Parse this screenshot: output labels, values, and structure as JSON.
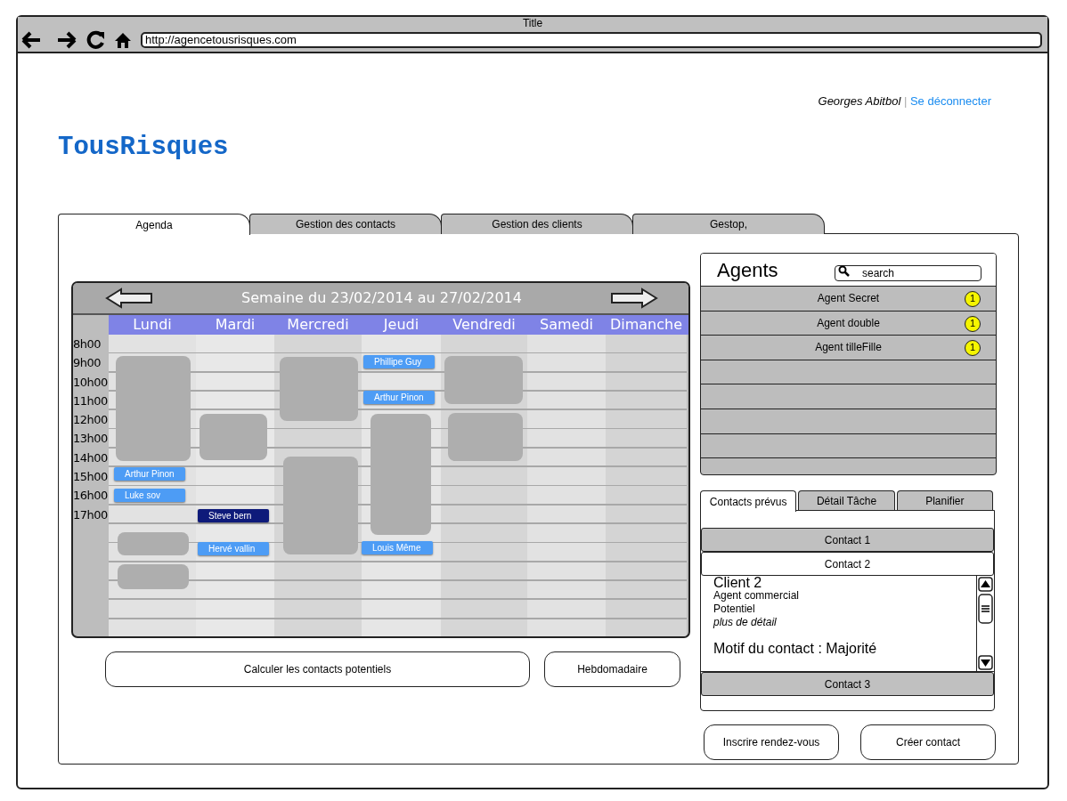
{
  "window": {
    "title": "Title",
    "url": "http://agencetousrisques.com"
  },
  "header": {
    "user": "Georges Abitbol",
    "separator": "|",
    "logout": "Se déconnecter",
    "logo": "TousRisques"
  },
  "tabs": [
    {
      "label": "Agenda",
      "selected": true
    },
    {
      "label": "Gestion des contacts",
      "selected": false
    },
    {
      "label": "Gestion des clients",
      "selected": false
    },
    {
      "label": "Gestop,",
      "selected": false
    }
  ],
  "calendar": {
    "title": "Semaine du 23/02/2014 au 27/02/2014",
    "hours": [
      "8h00",
      "9h00",
      "10h00",
      "11h00",
      "12h00",
      "13h00",
      "14h00",
      "15h00",
      "16h00",
      "17h00"
    ],
    "days": [
      {
        "label": "Lundi",
        "events": [
          {
            "name": "Arthur Pinon",
            "selected": false
          },
          {
            "name": "Luke sov",
            "selected": false
          }
        ]
      },
      {
        "label": "Mardi",
        "events": [
          {
            "name": "Steve bern",
            "selected": true
          },
          {
            "name": "Hervé vallin",
            "selected": false
          }
        ]
      },
      {
        "label": "Mercredi"
      },
      {
        "label": "Jeudi",
        "events": [
          {
            "name": "Phillipe Guy",
            "selected": false
          },
          {
            "name": "Arthur Pinon",
            "selected": false
          },
          {
            "name": "Louis Même",
            "selected": false
          }
        ]
      },
      {
        "label": "Vendredi"
      },
      {
        "label": "Samedi"
      },
      {
        "label": "Dimanche"
      }
    ]
  },
  "actions": [
    "Calculer les contacts potentiels",
    "Hebdomadaire"
  ],
  "agents": {
    "title": "Agents",
    "search": {
      "placeholder": "search"
    },
    "items": [
      {
        "name": "Agent Secret",
        "badge": "1"
      },
      {
        "name": "Agent double",
        "badge": "1"
      },
      {
        "name": "Agent tilleFille",
        "badge": "1"
      }
    ]
  },
  "contacts": {
    "tabs": [
      {
        "label": "Contacts prévus",
        "selected": true
      },
      {
        "label": "Détail Tâche",
        "selected": false
      },
      {
        "label": "Planifier",
        "selected": false
      }
    ],
    "items": [
      {
        "title": "Contact 1",
        "expanded": false
      },
      {
        "title": "Contact 2",
        "expanded": true,
        "detail": {
          "client": "Client 2",
          "lines": [
            "Agent commercial",
            "Potentiel"
          ],
          "link": "plus de détail",
          "motif": "Motif du contact : Majorité"
        }
      },
      {
        "title": "Contact 3",
        "expanded": false
      }
    ]
  },
  "buttons": [
    "Inscrire rendez-vous",
    "Créer contact"
  ]
}
